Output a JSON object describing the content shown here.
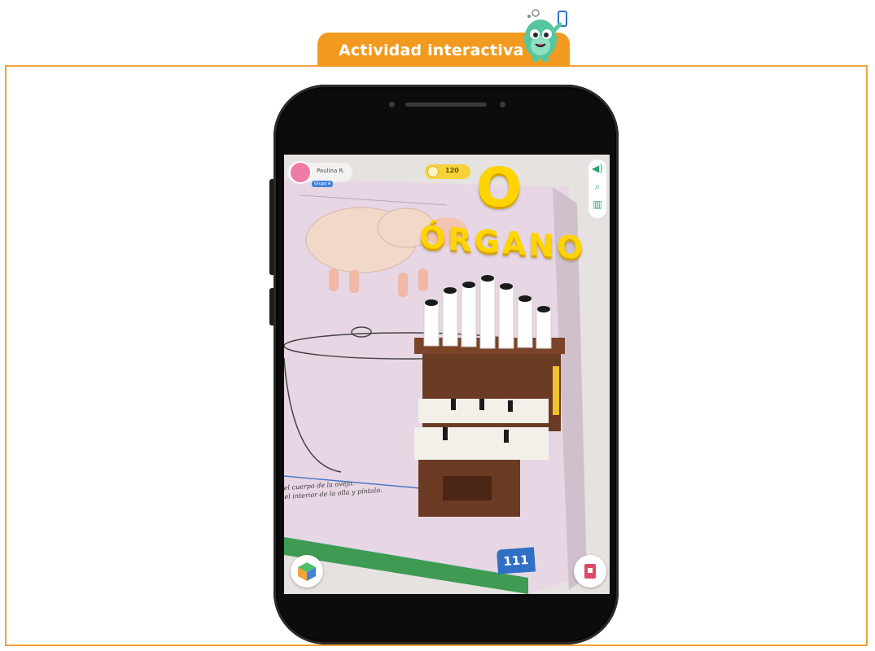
{
  "header": {
    "tab_label": "Actividad interactiva"
  },
  "colors": {
    "accent": "#f29a1f",
    "frame": "#f0a23a",
    "letter": "#ffd400",
    "tool_icon": "#28a66d",
    "page_number_bg": "#2f6fc4"
  },
  "app": {
    "user": {
      "name": "Paulina R.",
      "class_badge": "Grupo A"
    },
    "coins": "120",
    "letter": "O",
    "word": "ÓRGANO",
    "tools": [
      {
        "icon": "speaker-icon",
        "glyph": "🔊"
      },
      {
        "icon": "search-icon",
        "glyph": "⌕"
      },
      {
        "icon": "library-icon",
        "glyph": "▥"
      }
    ],
    "page_caption_line1": "el cuerpo de la oveja.",
    "page_caption_line2": "el interior de la olla y píntalo.",
    "page_number": "111",
    "bottom_left_button": "cube-icon",
    "bottom_right_button": "card-icon"
  }
}
